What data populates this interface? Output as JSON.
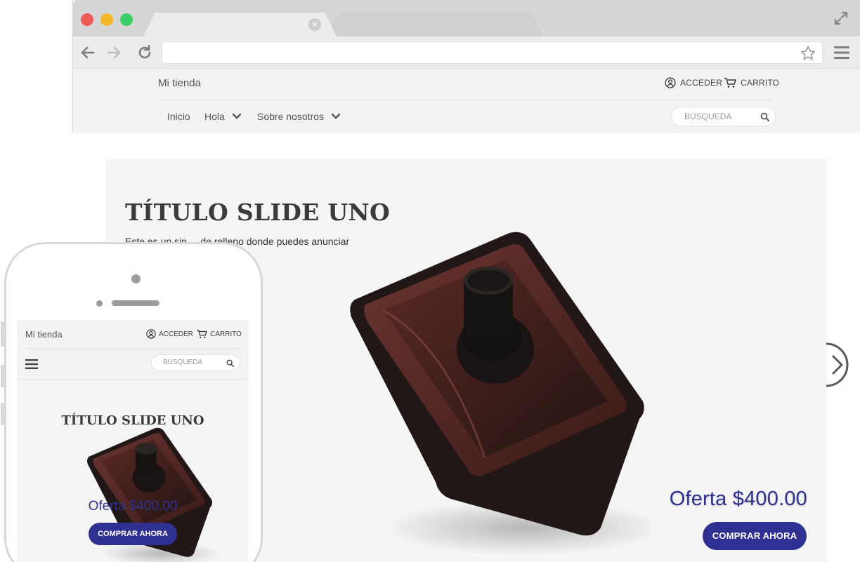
{
  "store": {
    "brand": "Mi tienda",
    "login_label": "ACCEDER",
    "cart_label": "CARRITO",
    "menu": [
      {
        "label": "Inicio"
      },
      {
        "label": "Hola"
      },
      {
        "label": "Sobre nosotros"
      }
    ],
    "search_placeholder": "BÚSQUEDA"
  },
  "slide": {
    "title": "TÍTULO SLIDE UNO",
    "subtitle": "Este es un sin ... de relleno donde puedes anunciar",
    "offer": "Oferta $400.00",
    "cta": "COMPRAR AHORA"
  },
  "mobile": {
    "brand": "Mi tienda",
    "login_label": "ACCEDER",
    "cart_label": "CARRITO",
    "search_placeholder": "BÚSQUEDA",
    "title": "TÍTULO SLIDE UNO",
    "offer": "Oferta $400.00",
    "cta": "COMPRAR AHORA"
  },
  "colors": {
    "accent": "#2e3191",
    "close_red": "#ee5a55",
    "minimize_yellow": "#f3b82c",
    "zoom_green": "#3bcd68"
  },
  "icons": [
    "back-arrow-icon",
    "forward-arrow-icon",
    "reload-icon",
    "star-icon",
    "hamburger-menu-icon",
    "expand-icon",
    "user-icon",
    "cart-icon",
    "search-icon",
    "chevron-down-icon",
    "chevron-right-icon"
  ]
}
